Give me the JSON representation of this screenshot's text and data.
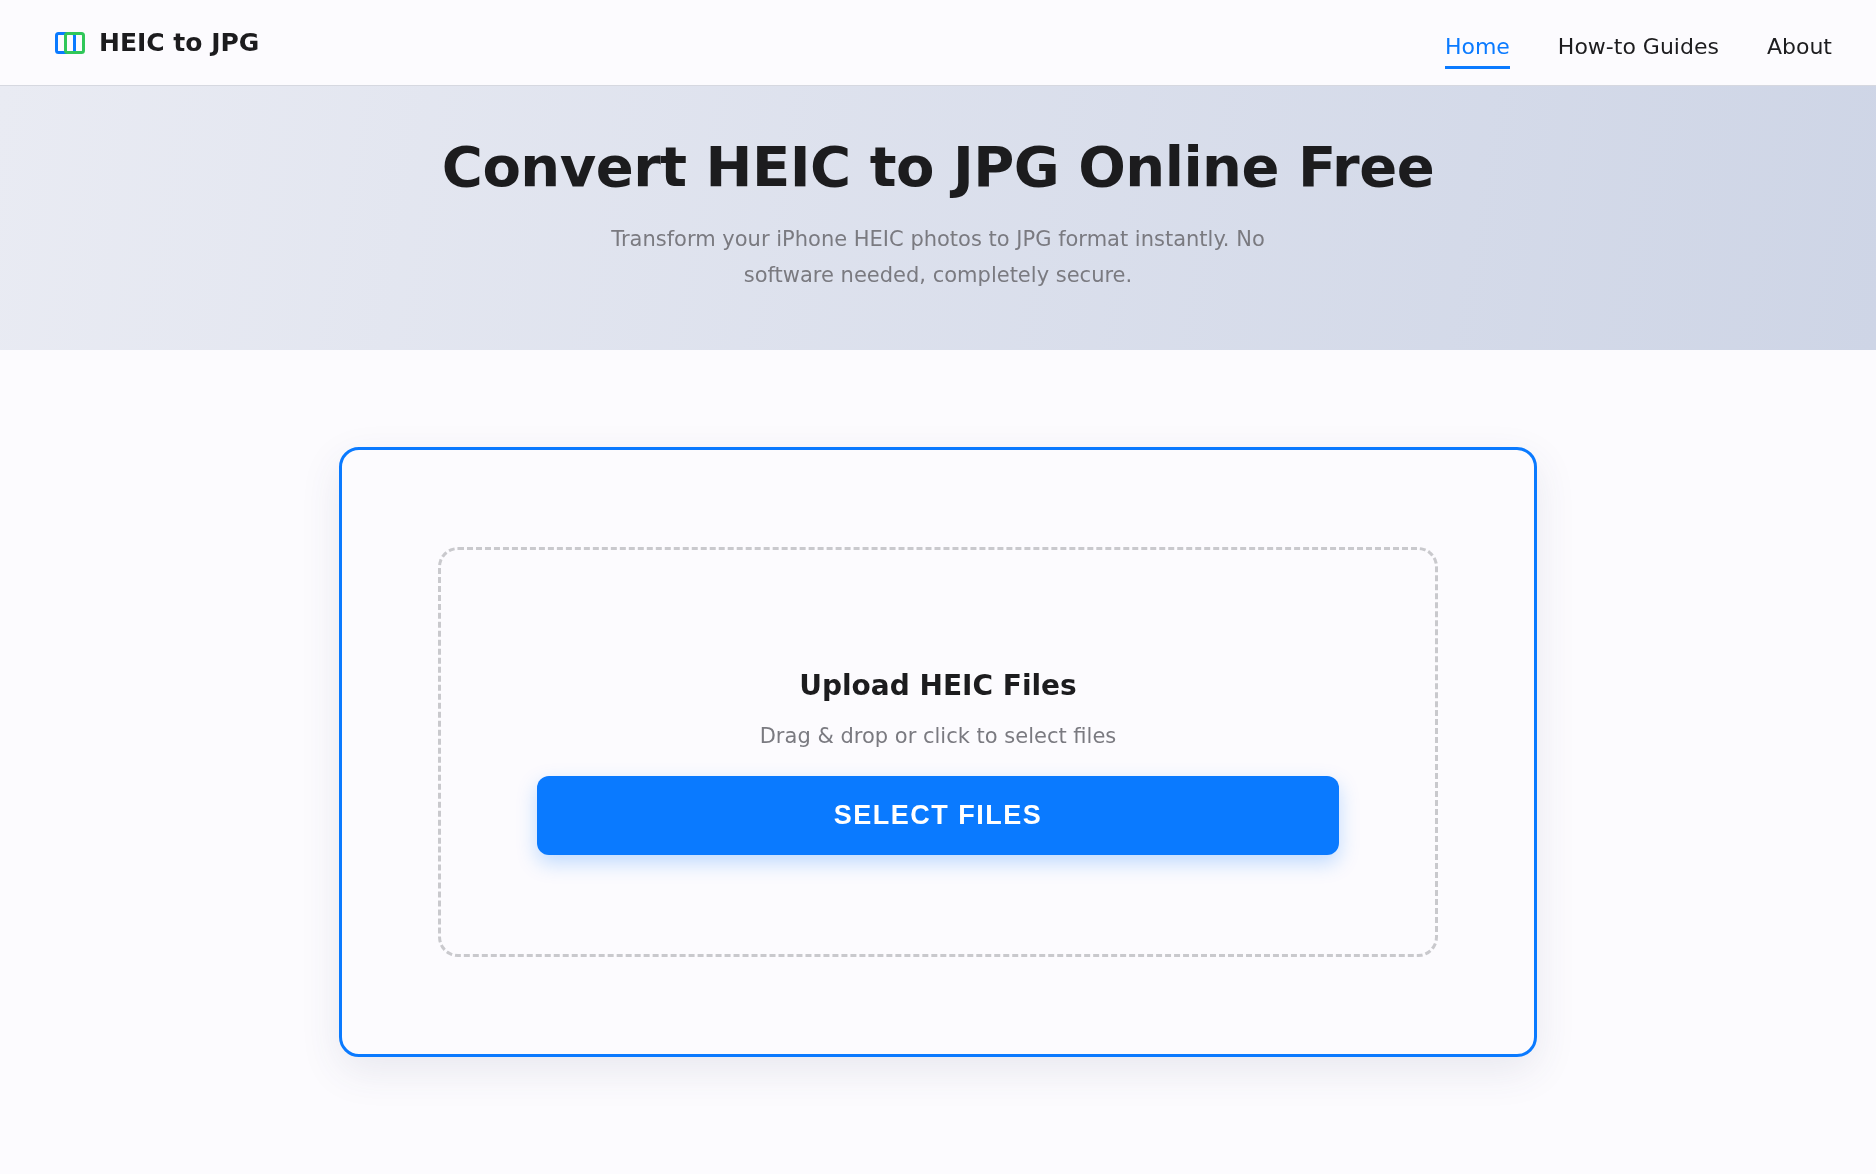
{
  "brand": {
    "name": "HEIC to JPG"
  },
  "nav": [
    {
      "label": "Home",
      "selected": true
    },
    {
      "label": "How-to Guides",
      "selected": false
    },
    {
      "label": "About",
      "selected": false
    }
  ],
  "hero": {
    "title": "Convert HEIC to JPG Online Free",
    "subtitle": "Transform your iPhone HEIC photos to JPG format instantly. No software needed, completely secure."
  },
  "upload": {
    "title": "Upload HEIC Files",
    "hint": "Drag & drop or click to select files",
    "button": "SELECT FILES"
  }
}
